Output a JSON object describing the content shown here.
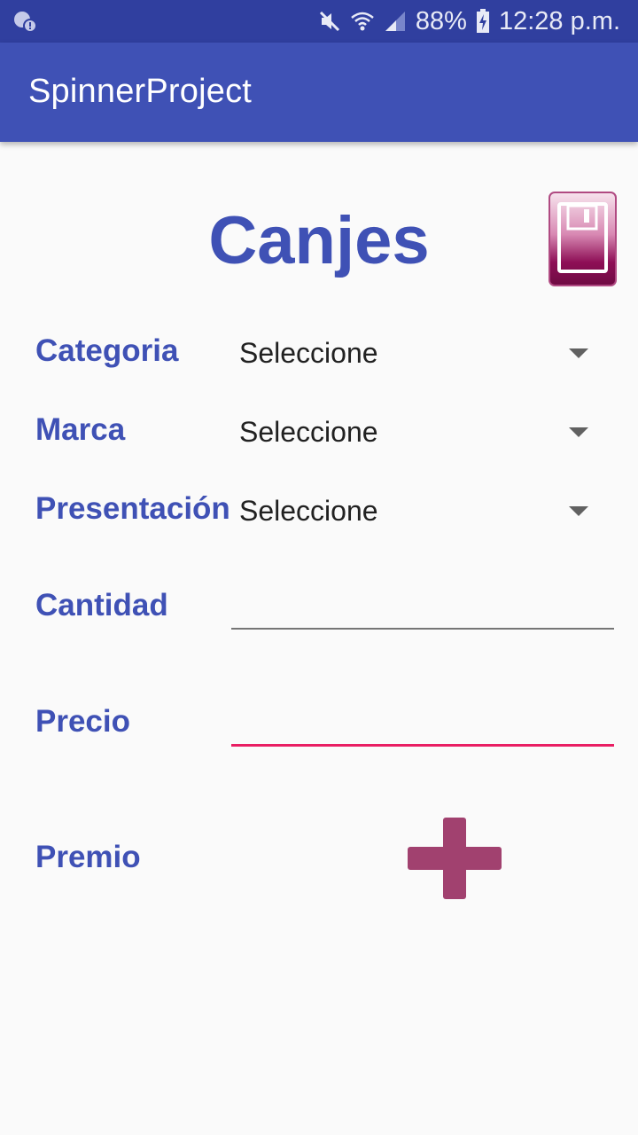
{
  "status_bar": {
    "battery_percent": "88%",
    "time": "12:28 p.m.",
    "icons": [
      "notification-icon",
      "mute-icon",
      "wifi-icon",
      "signal-icon",
      "battery-charging-icon"
    ]
  },
  "app_bar": {
    "title": "SpinnerProject"
  },
  "heading": "Canjes",
  "save_button": {
    "icon": "save-floppy-icon",
    "color": "#8e0f56"
  },
  "form": {
    "categoria": {
      "label": "Categoria",
      "value": "Seleccione"
    },
    "marca": {
      "label": "Marca",
      "value": "Seleccione"
    },
    "presentacion": {
      "label": "Presentación",
      "value": "Seleccione"
    },
    "cantidad": {
      "label": "Cantidad",
      "value": ""
    },
    "precio": {
      "label": "Precio",
      "value": ""
    },
    "premio": {
      "label": "Premio",
      "add_icon": "plus-icon",
      "add_color": "#a1416f"
    }
  },
  "colors": {
    "primary": "#3f51b5",
    "primary_dark": "#303f9f",
    "accent": "#e91e63"
  }
}
